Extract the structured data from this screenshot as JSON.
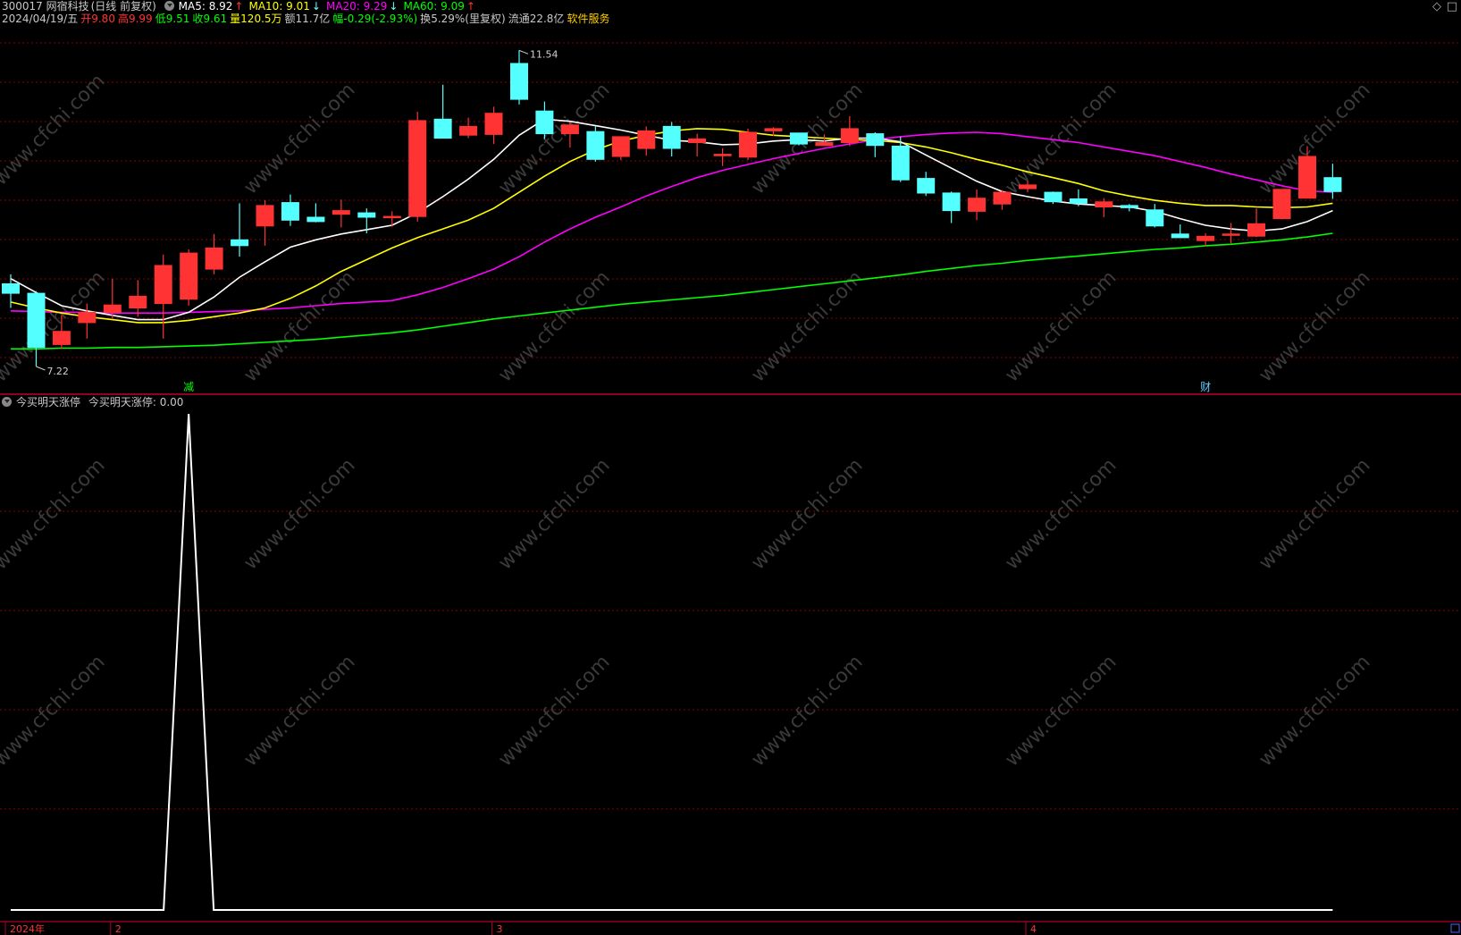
{
  "header": {
    "code_name": "300017 网宿科技",
    "period": "(日线 前复权)",
    "ma": [
      {
        "label": "MA5: 8.92",
        "color": "#ffffff",
        "arrow": "↑"
      },
      {
        "label": "MA10: 9.01",
        "color": "#ffff00",
        "arrow": "↓"
      },
      {
        "label": "MA20: 9.29",
        "color": "#ff00ff",
        "arrow": "↓"
      },
      {
        "label": "MA60: 9.09",
        "color": "#00ff00",
        "arrow": "↑"
      }
    ]
  },
  "quote": {
    "date": "2024/04/19/五",
    "open_label": "开",
    "open": "9.80",
    "high_label": "高",
    "high": "9.99",
    "low_label": "低",
    "low": "9.51",
    "close_label": "收",
    "close": "9.61",
    "volume_label": "量",
    "volume": "120.5万",
    "amount_label": "额",
    "amount": "11.7亿",
    "change_label": "幅",
    "change": "-0.29(-2.93%)",
    "turnover_label": "换",
    "turnover": "5.29%(里复权)",
    "float_label": "流通",
    "float": "22.8亿",
    "sector": "软件服务"
  },
  "indicator": {
    "name": "今买明天涨停",
    "value_label": "今买明天涨停: 0.00"
  },
  "markers": {
    "high_label": "11.54",
    "low_label": "7.22",
    "event_1": "减",
    "event_2": "财"
  },
  "watermark": "www.cfchi.com",
  "colors": {
    "up": "#ff3333",
    "down": "#54ffff",
    "ma5": "#ffffff",
    "ma10": "#ffff00",
    "ma20": "#ff00ff",
    "ma60": "#00ff00",
    "grid": "#8b0000",
    "axis": "#b0002a"
  },
  "chart_data": [
    {
      "type": "candlestick",
      "title": "300017 网宿科技 (日线 前复权)",
      "price_range": [
        7.0,
        11.8
      ],
      "candles": [
        {
          "o": 8.35,
          "h": 8.48,
          "l": 8.02,
          "c": 8.22
        },
        {
          "o": 8.22,
          "h": 8.25,
          "l": 7.22,
          "c": 7.48
        },
        {
          "o": 7.52,
          "h": 7.92,
          "l": 7.46,
          "c": 7.7
        },
        {
          "o": 7.82,
          "h": 8.08,
          "l": 7.6,
          "c": 7.96
        },
        {
          "o": 7.96,
          "h": 8.42,
          "l": 7.88,
          "c": 8.06
        },
        {
          "o": 8.02,
          "h": 8.4,
          "l": 7.9,
          "c": 8.18
        },
        {
          "o": 8.08,
          "h": 8.75,
          "l": 7.6,
          "c": 8.6
        },
        {
          "o": 8.14,
          "h": 8.82,
          "l": 8.05,
          "c": 8.77
        },
        {
          "o": 8.55,
          "h": 9.03,
          "l": 8.48,
          "c": 8.84
        },
        {
          "o": 8.95,
          "h": 9.45,
          "l": 8.72,
          "c": 8.87
        },
        {
          "o": 9.14,
          "h": 9.49,
          "l": 8.87,
          "c": 9.42
        },
        {
          "o": 9.46,
          "h": 9.57,
          "l": 9.14,
          "c": 9.22
        },
        {
          "o": 9.26,
          "h": 9.45,
          "l": 9.19,
          "c": 9.2
        },
        {
          "o": 9.3,
          "h": 9.5,
          "l": 9.12,
          "c": 9.35
        },
        {
          "o": 9.32,
          "h": 9.38,
          "l": 9.04,
          "c": 9.26
        },
        {
          "o": 9.26,
          "h": 9.34,
          "l": 9.13,
          "c": 9.27
        },
        {
          "o": 9.27,
          "h": 10.7,
          "l": 9.2,
          "c": 10.58
        },
        {
          "o": 10.6,
          "h": 11.07,
          "l": 10.38,
          "c": 10.34
        },
        {
          "o": 10.38,
          "h": 10.62,
          "l": 10.34,
          "c": 10.5
        },
        {
          "o": 10.39,
          "h": 10.77,
          "l": 10.26,
          "c": 10.68
        },
        {
          "o": 11.36,
          "h": 11.54,
          "l": 10.8,
          "c": 10.87
        },
        {
          "o": 10.71,
          "h": 10.84,
          "l": 10.33,
          "c": 10.4
        },
        {
          "o": 10.4,
          "h": 10.56,
          "l": 10.21,
          "c": 10.52
        },
        {
          "o": 10.43,
          "h": 10.5,
          "l": 10.02,
          "c": 10.05
        },
        {
          "o": 10.09,
          "h": 10.36,
          "l": 10.04,
          "c": 10.36
        },
        {
          "o": 10.2,
          "h": 10.5,
          "l": 10.1,
          "c": 10.44
        },
        {
          "o": 10.5,
          "h": 10.56,
          "l": 10.09,
          "c": 10.2
        },
        {
          "o": 10.28,
          "h": 10.4,
          "l": 10.09,
          "c": 10.33
        },
        {
          "o": 10.1,
          "h": 10.2,
          "l": 9.96,
          "c": 10.12
        },
        {
          "o": 10.08,
          "h": 10.47,
          "l": 10.04,
          "c": 10.42
        },
        {
          "o": 10.44,
          "h": 10.49,
          "l": 10.37,
          "c": 10.47
        },
        {
          "o": 10.41,
          "h": 10.41,
          "l": 10.24,
          "c": 10.26
        },
        {
          "o": 10.24,
          "h": 10.39,
          "l": 10.24,
          "c": 10.28
        },
        {
          "o": 10.28,
          "h": 10.64,
          "l": 10.23,
          "c": 10.47
        },
        {
          "o": 10.4,
          "h": 10.42,
          "l": 10.08,
          "c": 10.24
        },
        {
          "o": 10.23,
          "h": 10.36,
          "l": 9.74,
          "c": 9.77
        },
        {
          "o": 9.79,
          "h": 9.88,
          "l": 9.55,
          "c": 9.59
        },
        {
          "o": 9.59,
          "h": 9.61,
          "l": 9.18,
          "c": 9.35
        },
        {
          "o": 9.34,
          "h": 9.64,
          "l": 9.22,
          "c": 9.52
        },
        {
          "o": 9.44,
          "h": 9.63,
          "l": 9.36,
          "c": 9.6
        },
        {
          "o": 9.65,
          "h": 9.76,
          "l": 9.6,
          "c": 9.7
        },
        {
          "o": 9.6,
          "h": 9.61,
          "l": 9.44,
          "c": 9.47
        },
        {
          "o": 9.51,
          "h": 9.64,
          "l": 9.41,
          "c": 9.45
        },
        {
          "o": 9.4,
          "h": 9.52,
          "l": 9.26,
          "c": 9.47
        },
        {
          "o": 9.42,
          "h": 9.44,
          "l": 9.34,
          "c": 9.39
        },
        {
          "o": 9.36,
          "h": 9.44,
          "l": 9.12,
          "c": 9.14
        },
        {
          "o": 9.03,
          "h": 9.16,
          "l": 8.98,
          "c": 8.98
        },
        {
          "o": 8.94,
          "h": 9.04,
          "l": 8.86,
          "c": 9.0
        },
        {
          "o": 9.03,
          "h": 9.18,
          "l": 8.9,
          "c": 9.03
        },
        {
          "o": 9.0,
          "h": 9.38,
          "l": 8.99,
          "c": 9.17
        },
        {
          "o": 9.24,
          "h": 9.64,
          "l": 9.23,
          "c": 9.64
        },
        {
          "o": 9.52,
          "h": 10.23,
          "l": 9.52,
          "c": 10.09
        },
        {
          "o": 9.8,
          "h": 9.99,
          "l": 9.51,
          "c": 9.61
        }
      ],
      "ma5": [
        8.42,
        8.23,
        8.05,
        7.98,
        7.92,
        7.86,
        7.86,
        7.96,
        8.17,
        8.44,
        8.65,
        8.85,
        8.95,
        9.03,
        9.09,
        9.15,
        9.32,
        9.54,
        9.78,
        10.05,
        10.38,
        10.6,
        10.57,
        10.51,
        10.45,
        10.38,
        10.31,
        10.29,
        10.25,
        10.26,
        10.3,
        10.32,
        10.3,
        10.34,
        10.34,
        10.29,
        10.11,
        9.93,
        9.75,
        9.61,
        9.54,
        9.48,
        9.44,
        9.42,
        9.4,
        9.34,
        9.24,
        9.15,
        9.1,
        9.07,
        9.1,
        9.2,
        9.35
      ],
      "ma10": [
        8.1,
        8.02,
        7.95,
        7.9,
        7.86,
        7.82,
        7.82,
        7.85,
        7.9,
        7.95,
        8.02,
        8.15,
        8.32,
        8.52,
        8.68,
        8.84,
        8.98,
        9.1,
        9.22,
        9.38,
        9.6,
        9.82,
        10.02,
        10.18,
        10.3,
        10.38,
        10.44,
        10.47,
        10.46,
        10.42,
        10.38,
        10.36,
        10.34,
        10.32,
        10.31,
        10.28,
        10.22,
        10.14,
        10.05,
        9.97,
        9.88,
        9.8,
        9.72,
        9.62,
        9.55,
        9.49,
        9.45,
        9.42,
        9.42,
        9.4,
        9.39,
        9.4,
        9.45
      ],
      "ma20": [
        7.98,
        7.97,
        7.96,
        7.96,
        7.95,
        7.95,
        7.95,
        7.96,
        7.97,
        7.98,
        8.0,
        8.02,
        8.05,
        8.08,
        8.1,
        8.12,
        8.2,
        8.3,
        8.42,
        8.55,
        8.72,
        8.92,
        9.1,
        9.26,
        9.4,
        9.55,
        9.68,
        9.8,
        9.9,
        9.98,
        10.06,
        10.13,
        10.2,
        10.26,
        10.32,
        10.36,
        10.39,
        10.41,
        10.42,
        10.4,
        10.36,
        10.32,
        10.28,
        10.22,
        10.16,
        10.1,
        10.02,
        9.94,
        9.85,
        9.77,
        9.69,
        9.62,
        9.6
      ],
      "ma60": [
        7.46,
        7.46,
        7.47,
        7.47,
        7.48,
        7.48,
        7.49,
        7.5,
        7.51,
        7.53,
        7.55,
        7.57,
        7.59,
        7.62,
        7.65,
        7.68,
        7.72,
        7.77,
        7.82,
        7.87,
        7.91,
        7.95,
        7.99,
        8.03,
        8.07,
        8.1,
        8.13,
        8.16,
        8.19,
        8.23,
        8.27,
        8.31,
        8.35,
        8.39,
        8.43,
        8.47,
        8.52,
        8.56,
        8.6,
        8.63,
        8.67,
        8.7,
        8.73,
        8.76,
        8.79,
        8.82,
        8.84,
        8.87,
        8.89,
        8.92,
        8.95,
        8.99,
        9.04
      ]
    },
    {
      "type": "line",
      "title": "今买明天涨停",
      "series": [
        {
          "name": "今买明天涨停",
          "values": [
            0,
            0,
            0,
            0,
            0,
            0,
            0,
            1,
            0,
            0,
            0,
            0,
            0,
            0,
            0,
            0,
            0,
            0,
            0,
            0,
            0,
            0,
            0,
            0,
            0,
            0,
            0,
            0,
            0,
            0,
            0,
            0,
            0,
            0,
            0,
            0,
            0,
            0,
            0,
            0,
            0,
            0,
            0,
            0,
            0,
            0,
            0,
            0,
            0,
            0,
            0,
            0,
            0
          ]
        }
      ],
      "ylim": [
        0,
        1
      ]
    }
  ],
  "time_axis": {
    "labels": [
      {
        "text": "2024年",
        "index": 0
      },
      {
        "text": "2",
        "index": 4
      },
      {
        "text": "3",
        "index": 19
      },
      {
        "text": "4",
        "index": 40
      }
    ]
  }
}
